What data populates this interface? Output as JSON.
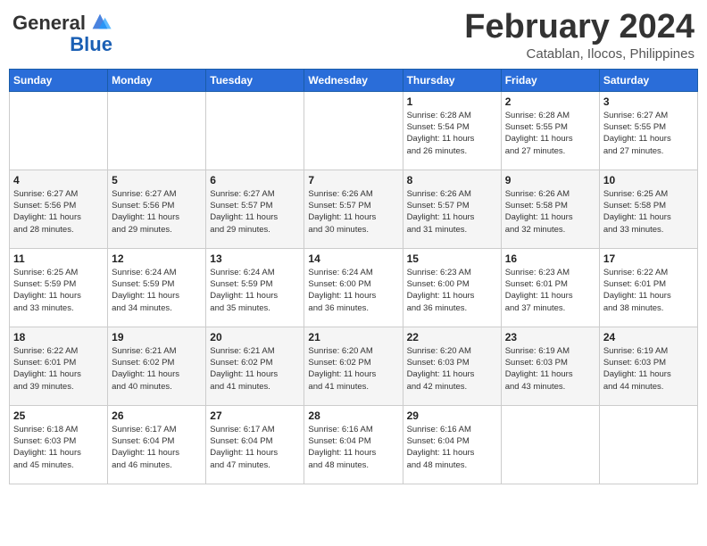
{
  "header": {
    "logo_line1": "General",
    "logo_line2": "Blue",
    "month_title": "February 2024",
    "location": "Catablan, Ilocos, Philippines"
  },
  "weekdays": [
    "Sunday",
    "Monday",
    "Tuesday",
    "Wednesday",
    "Thursday",
    "Friday",
    "Saturday"
  ],
  "weeks": [
    [
      {
        "day": "",
        "info": ""
      },
      {
        "day": "",
        "info": ""
      },
      {
        "day": "",
        "info": ""
      },
      {
        "day": "",
        "info": ""
      },
      {
        "day": "1",
        "info": "Sunrise: 6:28 AM\nSunset: 5:54 PM\nDaylight: 11 hours\nand 26 minutes."
      },
      {
        "day": "2",
        "info": "Sunrise: 6:28 AM\nSunset: 5:55 PM\nDaylight: 11 hours\nand 27 minutes."
      },
      {
        "day": "3",
        "info": "Sunrise: 6:27 AM\nSunset: 5:55 PM\nDaylight: 11 hours\nand 27 minutes."
      }
    ],
    [
      {
        "day": "4",
        "info": "Sunrise: 6:27 AM\nSunset: 5:56 PM\nDaylight: 11 hours\nand 28 minutes."
      },
      {
        "day": "5",
        "info": "Sunrise: 6:27 AM\nSunset: 5:56 PM\nDaylight: 11 hours\nand 29 minutes."
      },
      {
        "day": "6",
        "info": "Sunrise: 6:27 AM\nSunset: 5:57 PM\nDaylight: 11 hours\nand 29 minutes."
      },
      {
        "day": "7",
        "info": "Sunrise: 6:26 AM\nSunset: 5:57 PM\nDaylight: 11 hours\nand 30 minutes."
      },
      {
        "day": "8",
        "info": "Sunrise: 6:26 AM\nSunset: 5:57 PM\nDaylight: 11 hours\nand 31 minutes."
      },
      {
        "day": "9",
        "info": "Sunrise: 6:26 AM\nSunset: 5:58 PM\nDaylight: 11 hours\nand 32 minutes."
      },
      {
        "day": "10",
        "info": "Sunrise: 6:25 AM\nSunset: 5:58 PM\nDaylight: 11 hours\nand 33 minutes."
      }
    ],
    [
      {
        "day": "11",
        "info": "Sunrise: 6:25 AM\nSunset: 5:59 PM\nDaylight: 11 hours\nand 33 minutes."
      },
      {
        "day": "12",
        "info": "Sunrise: 6:24 AM\nSunset: 5:59 PM\nDaylight: 11 hours\nand 34 minutes."
      },
      {
        "day": "13",
        "info": "Sunrise: 6:24 AM\nSunset: 5:59 PM\nDaylight: 11 hours\nand 35 minutes."
      },
      {
        "day": "14",
        "info": "Sunrise: 6:24 AM\nSunset: 6:00 PM\nDaylight: 11 hours\nand 36 minutes."
      },
      {
        "day": "15",
        "info": "Sunrise: 6:23 AM\nSunset: 6:00 PM\nDaylight: 11 hours\nand 36 minutes."
      },
      {
        "day": "16",
        "info": "Sunrise: 6:23 AM\nSunset: 6:01 PM\nDaylight: 11 hours\nand 37 minutes."
      },
      {
        "day": "17",
        "info": "Sunrise: 6:22 AM\nSunset: 6:01 PM\nDaylight: 11 hours\nand 38 minutes."
      }
    ],
    [
      {
        "day": "18",
        "info": "Sunrise: 6:22 AM\nSunset: 6:01 PM\nDaylight: 11 hours\nand 39 minutes."
      },
      {
        "day": "19",
        "info": "Sunrise: 6:21 AM\nSunset: 6:02 PM\nDaylight: 11 hours\nand 40 minutes."
      },
      {
        "day": "20",
        "info": "Sunrise: 6:21 AM\nSunset: 6:02 PM\nDaylight: 11 hours\nand 41 minutes."
      },
      {
        "day": "21",
        "info": "Sunrise: 6:20 AM\nSunset: 6:02 PM\nDaylight: 11 hours\nand 41 minutes."
      },
      {
        "day": "22",
        "info": "Sunrise: 6:20 AM\nSunset: 6:03 PM\nDaylight: 11 hours\nand 42 minutes."
      },
      {
        "day": "23",
        "info": "Sunrise: 6:19 AM\nSunset: 6:03 PM\nDaylight: 11 hours\nand 43 minutes."
      },
      {
        "day": "24",
        "info": "Sunrise: 6:19 AM\nSunset: 6:03 PM\nDaylight: 11 hours\nand 44 minutes."
      }
    ],
    [
      {
        "day": "25",
        "info": "Sunrise: 6:18 AM\nSunset: 6:03 PM\nDaylight: 11 hours\nand 45 minutes."
      },
      {
        "day": "26",
        "info": "Sunrise: 6:17 AM\nSunset: 6:04 PM\nDaylight: 11 hours\nand 46 minutes."
      },
      {
        "day": "27",
        "info": "Sunrise: 6:17 AM\nSunset: 6:04 PM\nDaylight: 11 hours\nand 47 minutes."
      },
      {
        "day": "28",
        "info": "Sunrise: 6:16 AM\nSunset: 6:04 PM\nDaylight: 11 hours\nand 48 minutes."
      },
      {
        "day": "29",
        "info": "Sunrise: 6:16 AM\nSunset: 6:04 PM\nDaylight: 11 hours\nand 48 minutes."
      },
      {
        "day": "",
        "info": ""
      },
      {
        "day": "",
        "info": ""
      }
    ]
  ]
}
